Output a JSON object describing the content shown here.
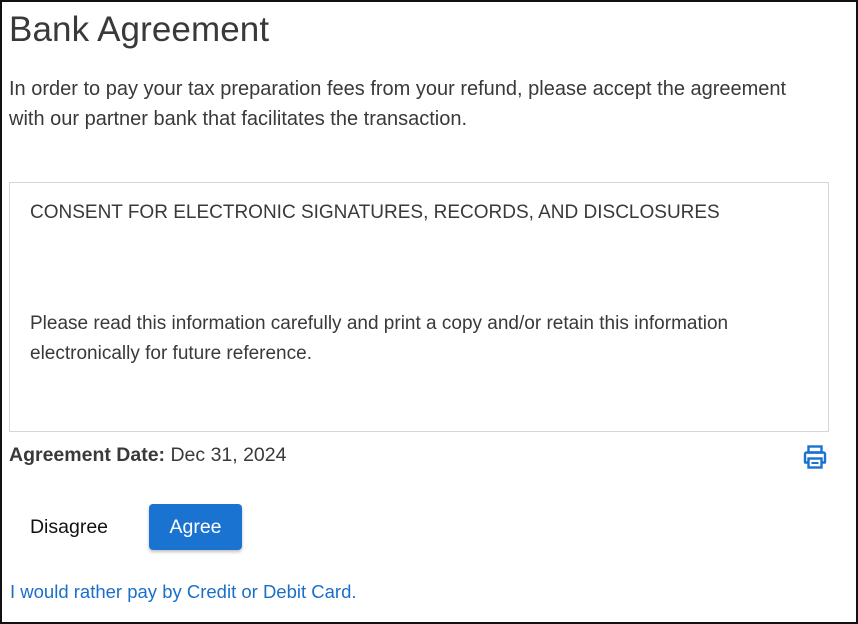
{
  "page": {
    "title": "Bank Agreement",
    "intro": "In order to pay your tax preparation fees from your refund, please accept the agreement with our partner bank that facilitates the transaction."
  },
  "agreement": {
    "heading": "CONSENT FOR ELECTRONIC SIGNATURES, RECORDS, AND DISCLOSURES",
    "body": "Please read this information carefully and print a copy and/or retain this information electronically for future reference."
  },
  "date": {
    "label": "Agreement Date:",
    "value": "Dec 31, 2024"
  },
  "actions": {
    "disagree_label": "Disagree",
    "agree_label": "Agree",
    "print_icon": "print-icon"
  },
  "alternative": {
    "link_text": "I would rather pay by Credit or Debit Card."
  },
  "colors": {
    "accent": "#1a73d0",
    "link": "#1a6fc9",
    "text": "#393939",
    "border": "#d6d6d6"
  }
}
